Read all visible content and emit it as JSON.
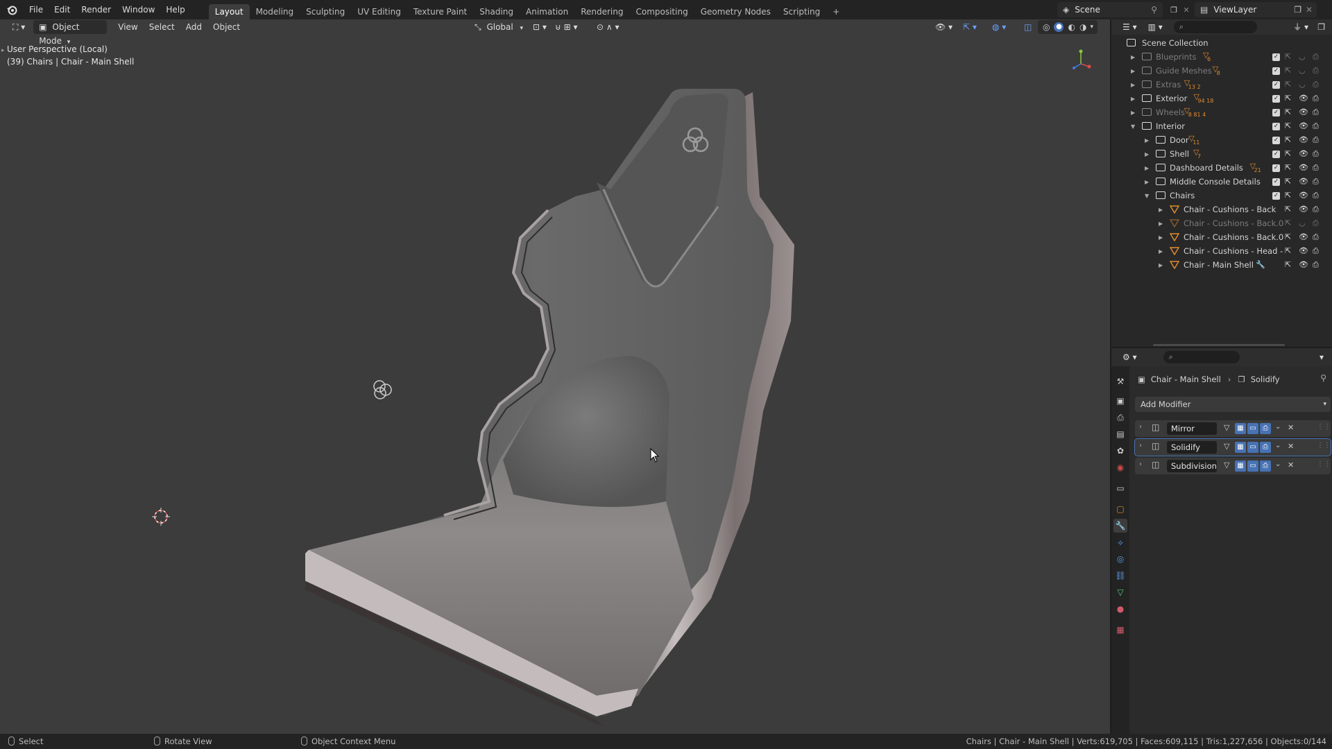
{
  "menu": {
    "items": [
      "File",
      "Edit",
      "Render",
      "Window",
      "Help"
    ],
    "workspaces": [
      "Layout",
      "Modeling",
      "Sculpting",
      "UV Editing",
      "Texture Paint",
      "Shading",
      "Animation",
      "Rendering",
      "Compositing",
      "Geometry Nodes",
      "Scripting"
    ],
    "active_workspace": "Layout",
    "add_tab": "+",
    "scene_name": "Scene",
    "view_layer": "ViewLayer"
  },
  "viewport": {
    "mode": "Object Mode",
    "menus": [
      "View",
      "Select",
      "Add",
      "Object"
    ],
    "transform_orientation": "Global",
    "perspective_label": "User Perspective (Local)",
    "object_label": "(39) Chairs | Chair - Main Shell"
  },
  "outliner": {
    "root": "Scene Collection",
    "rows": [
      {
        "label": "Blueprints",
        "type": "collection",
        "depth": 0,
        "expanded": false,
        "dimmed": true,
        "badge": "6",
        "checked": true,
        "visible": false
      },
      {
        "label": "Guide Meshes",
        "type": "collection",
        "depth": 0,
        "expanded": false,
        "dimmed": true,
        "badge": "8",
        "checked": true,
        "visible": false
      },
      {
        "label": "Extras",
        "type": "collection",
        "depth": 0,
        "expanded": false,
        "dimmed": true,
        "badge": "13  2",
        "checked": true,
        "visible": false
      },
      {
        "label": "Exterior",
        "type": "collection",
        "depth": 0,
        "expanded": false,
        "dimmed": false,
        "badge": "94  18",
        "checked": true,
        "visible": true
      },
      {
        "label": "Wheels",
        "type": "collection",
        "depth": 0,
        "expanded": false,
        "dimmed": true,
        "badge": "8  81  4",
        "checked": true,
        "visible": true
      },
      {
        "label": "Interior",
        "type": "collection",
        "depth": 0,
        "expanded": true,
        "dimmed": false,
        "badge": "",
        "checked": true,
        "visible": true
      },
      {
        "label": "Door",
        "type": "collection",
        "depth": 1,
        "expanded": false,
        "dimmed": false,
        "badge": "11",
        "checked": true,
        "visible": true
      },
      {
        "label": "Shell",
        "type": "collection",
        "depth": 1,
        "expanded": false,
        "dimmed": false,
        "badge": "7",
        "checked": true,
        "visible": true
      },
      {
        "label": "Dashboard Details",
        "type": "collection",
        "depth": 1,
        "expanded": false,
        "dimmed": false,
        "badge": "21",
        "checked": true,
        "visible": true
      },
      {
        "label": "Middle Console Details",
        "type": "collection",
        "depth": 1,
        "expanded": false,
        "dimmed": false,
        "badge": "",
        "checked": true,
        "visible": true
      },
      {
        "label": "Chairs",
        "type": "collection",
        "depth": 1,
        "expanded": true,
        "dimmed": false,
        "badge": "",
        "checked": true,
        "visible": true
      },
      {
        "label": "Chair - Cushions - Back",
        "type": "mesh",
        "depth": 2,
        "expanded": false,
        "dimmed": false,
        "badge": "",
        "checked": false,
        "visible": true
      },
      {
        "label": "Chair - Cushions - Back.0",
        "type": "mesh",
        "depth": 2,
        "expanded": false,
        "dimmed": true,
        "badge": "",
        "checked": false,
        "visible": false
      },
      {
        "label": "Chair - Cushions - Back.0",
        "type": "mesh",
        "depth": 2,
        "expanded": false,
        "dimmed": false,
        "badge": "",
        "checked": false,
        "visible": true
      },
      {
        "label": "Chair - Cushions - Head -",
        "type": "mesh",
        "depth": 2,
        "expanded": false,
        "dimmed": false,
        "badge": "",
        "checked": false,
        "visible": true
      },
      {
        "label": "Chair - Main Shell",
        "type": "mesh",
        "depth": 2,
        "expanded": false,
        "dimmed": false,
        "badge": "",
        "checked": false,
        "visible": true
      }
    ]
  },
  "properties": {
    "breadcrumb_object": "Chair - Main Shell",
    "breadcrumb_modifier": "Solidify",
    "add_modifier": "Add Modifier",
    "modifiers": [
      {
        "name": "Mirror",
        "icon": "mirror-icon"
      },
      {
        "name": "Solidify",
        "icon": "solidify-icon"
      },
      {
        "name": "Subdivision",
        "icon": "subdivision-icon"
      }
    ],
    "active_tab": "modifier-tab"
  },
  "statusbar": {
    "select": "Select",
    "rotate": "Rotate View",
    "context_menu": "Object Context Menu",
    "stats": "Chairs | Chair - Main Shell | Verts:619,705 | Faces:609,115 | Tris:1,227,656 | Objects:0/144"
  },
  "colors": {
    "accent": "#4772b3",
    "orange": "#e08a2e",
    "viewport_bg": "#3c3c3c",
    "panel_bg": "#282828"
  }
}
